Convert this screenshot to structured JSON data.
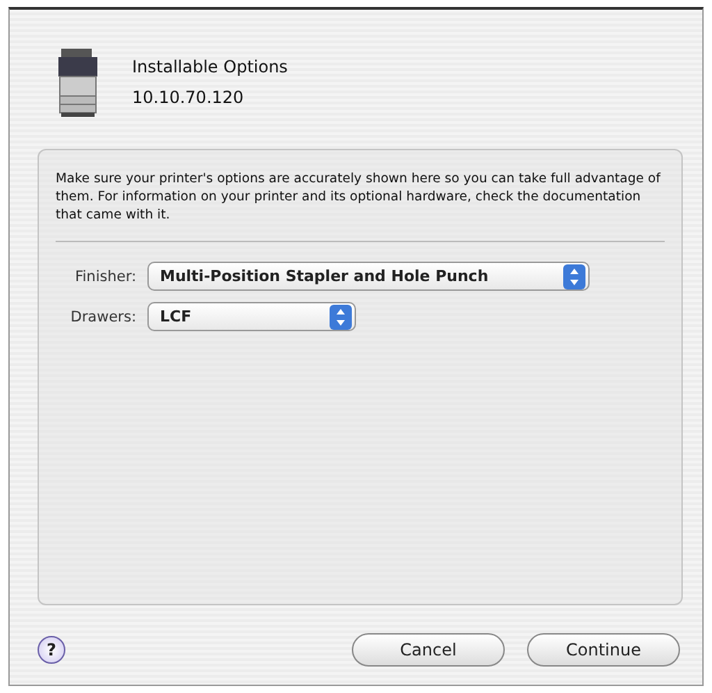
{
  "header": {
    "title": "Installable Options",
    "address": "10.10.70.120"
  },
  "intro": "Make sure your printer's options are accurately shown here so you can take full advantage of them.  For information on your printer and its optional hardware, check the documentation that came with it.",
  "options": [
    {
      "label": "Finisher:",
      "value": "Multi-Position Stapler and Hole Punch"
    },
    {
      "label": "Drawers:",
      "value": "LCF"
    }
  ],
  "help": "?",
  "buttons": [
    {
      "label": "Cancel"
    },
    {
      "label": "Continue"
    }
  ]
}
